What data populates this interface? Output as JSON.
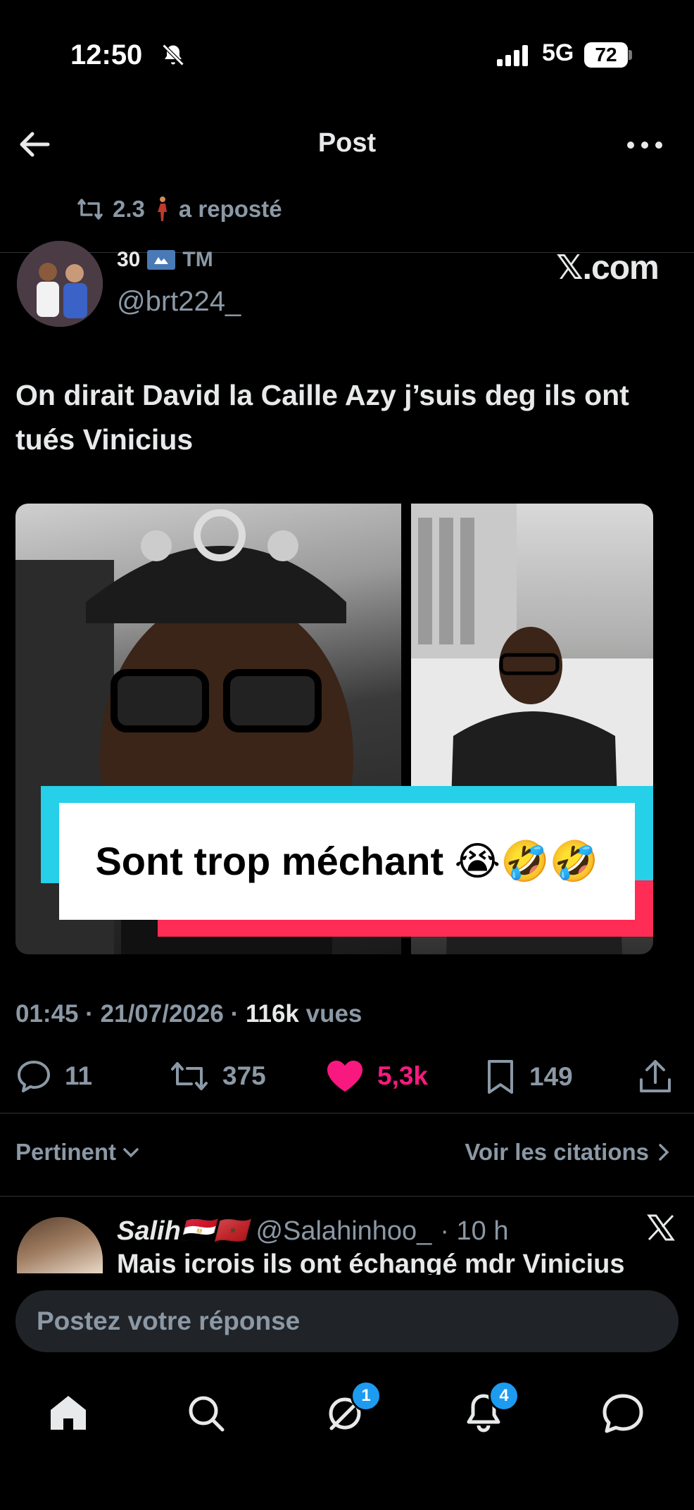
{
  "status_bar": {
    "time": "12:50",
    "network": "5G",
    "battery": "72"
  },
  "header": {
    "title": "Post"
  },
  "repost": {
    "count": "2.3",
    "label": "a reposté"
  },
  "author": {
    "name": "30",
    "badge": "TM",
    "handle": "@brt224_",
    "source": "𝕏.com"
  },
  "tweet": {
    "text": "On dirait David la Caille Azy j’suis deg ils ont tués Vinicius",
    "image_caption": "Sont trop méchant 😭🤣🤣"
  },
  "meta": {
    "time": "01:45",
    "date": "21/07/2026",
    "views_count": "116k",
    "views_label": "vues"
  },
  "actions": {
    "replies": "11",
    "reposts": "375",
    "likes": "5,3k",
    "bookmarks": "149"
  },
  "sort": {
    "label": "Pertinent",
    "quotes_label": "Voir les citations"
  },
  "reply": {
    "name": "Salih🇪🇬🇲🇦",
    "handle": "@Salahinhoo_",
    "time": "· 10 h",
    "text": "Mais icrois ils ont échangé mdr Vinicius"
  },
  "composer": {
    "placeholder": "Postez votre réponse"
  },
  "tabbar": {
    "messages_badge": "1",
    "notifications_badge": "4"
  },
  "colors": {
    "background": "#000000",
    "like": "#f91880",
    "muted": "#8b98a5",
    "badge": "#1d9bf0"
  }
}
